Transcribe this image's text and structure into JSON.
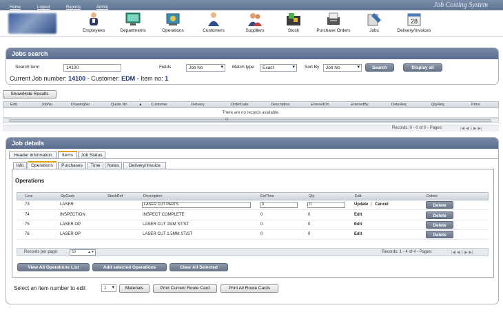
{
  "topbar": {
    "menu": [
      "Home",
      "Logout",
      "Reports",
      "Admin"
    ],
    "app_title": "Job Costing System"
  },
  "toolbar": {
    "items": [
      {
        "label": "Employees",
        "icon": "employees-icon"
      },
      {
        "label": "Departments",
        "icon": "departments-icon"
      },
      {
        "label": "Operations",
        "icon": "operations-icon"
      },
      {
        "label": "Customers",
        "icon": "customers-icon"
      },
      {
        "label": "Suppliers",
        "icon": "suppliers-icon"
      },
      {
        "label": "Stock",
        "icon": "stock-icon"
      },
      {
        "label": "Purchase Orders",
        "icon": "purchase-orders-icon"
      },
      {
        "label": "Jobs",
        "icon": "jobs-icon"
      },
      {
        "label": "Delivery/Invoices",
        "icon": "delivery-invoices-icon"
      }
    ]
  },
  "jobs_search": {
    "title": "Jobs search",
    "search_term_label": "Search term",
    "search_term_value": "14100",
    "fields_label": "Fields",
    "fields_value": "Job No",
    "match_type_label": "Match type",
    "match_type_value": "Exact",
    "sort_by_label": "Sort By",
    "sort_by_value": "Job No",
    "search_button": "Search",
    "display_all_button": "Display all",
    "current_prefix": "Current Job number:",
    "job_number": "14100",
    "customer_prefix": "- Customer:",
    "customer": "EDM",
    "item_prefix": "- Item no:",
    "item_no": "1"
  },
  "results": {
    "toggle_button": "Show/Hide Results",
    "columns": [
      "Edit",
      "JobNo",
      "DrawingNo",
      "Quote No",
      "▲",
      "Customer",
      "Delivery",
      "OrderDate",
      "Description",
      "EnteredOn",
      "EnteredBy",
      "DateReq",
      "QtyReq",
      "Price"
    ],
    "empty_message": "There are no records available.",
    "scroll_mark": "III",
    "pager_text": "Records: 0 - 0 of 0 - Pages:",
    "pager_nav": "|◀  ◀  1  ▶  ▶|"
  },
  "job_details": {
    "title": "Job details",
    "tabs": [
      "Header information",
      "Items",
      "Job Status"
    ],
    "active_tab": "Items",
    "subtabs": [
      "Info",
      "Operations",
      "Purchases",
      "Time",
      "Notes",
      "Delivery/Invoice"
    ],
    "active_subtab": "Operations",
    "section_title": "Operations",
    "columns": [
      "Line",
      "OpCode",
      "StockRef",
      "Description",
      "ExtTime",
      "Qty",
      "Edit",
      "Delete"
    ],
    "rows": [
      {
        "line": "73",
        "opcode": "LASER",
        "stockref": "",
        "description": "LASER CUT PARTS",
        "exttime": "0",
        "qty": "0",
        "edit": "Update",
        "edit2": "Cancel",
        "editing": true
      },
      {
        "line": "74",
        "opcode": "INSPECTION",
        "stockref": "",
        "description": "INSPECT COMPLETE",
        "exttime": "0",
        "qty": "0",
        "edit": "Edit",
        "edit2": "",
        "editing": false
      },
      {
        "line": "75",
        "opcode": "LASER OP",
        "stockref": "",
        "description": "LASER CUT 1MM ST/ST",
        "exttime": "0",
        "qty": "0",
        "edit": "Edit",
        "edit2": "",
        "editing": false
      },
      {
        "line": "76",
        "opcode": "LASER OP",
        "stockref": "",
        "description": "LASER CUT 1.5MM ST/ST",
        "exttime": "0",
        "qty": "0",
        "edit": "Edit",
        "edit2": "",
        "editing": false
      }
    ],
    "delete_label": "Delete",
    "records_per_page_label": "Records per page:",
    "records_per_page": "50",
    "pager_text": "Records: 1 - 4 of 4 - Pages:",
    "pager_nav": "|◀  ◀  1  ▶  ▶|",
    "view_all_button": "View All Operations List",
    "add_selected_button": "Add selected Operations",
    "clear_all_button": "Clear All Selected",
    "select_item_label": "Select an item number to edit",
    "item_number": "1",
    "materials_button": "Materials",
    "print_current_button": "Print Current Route Card",
    "print_all_button": "Print All Route Cards"
  },
  "colors": {
    "panel_header": "#5b6d8e",
    "accent_tab": "#e0a010",
    "job_text": "#1b2f7a"
  }
}
